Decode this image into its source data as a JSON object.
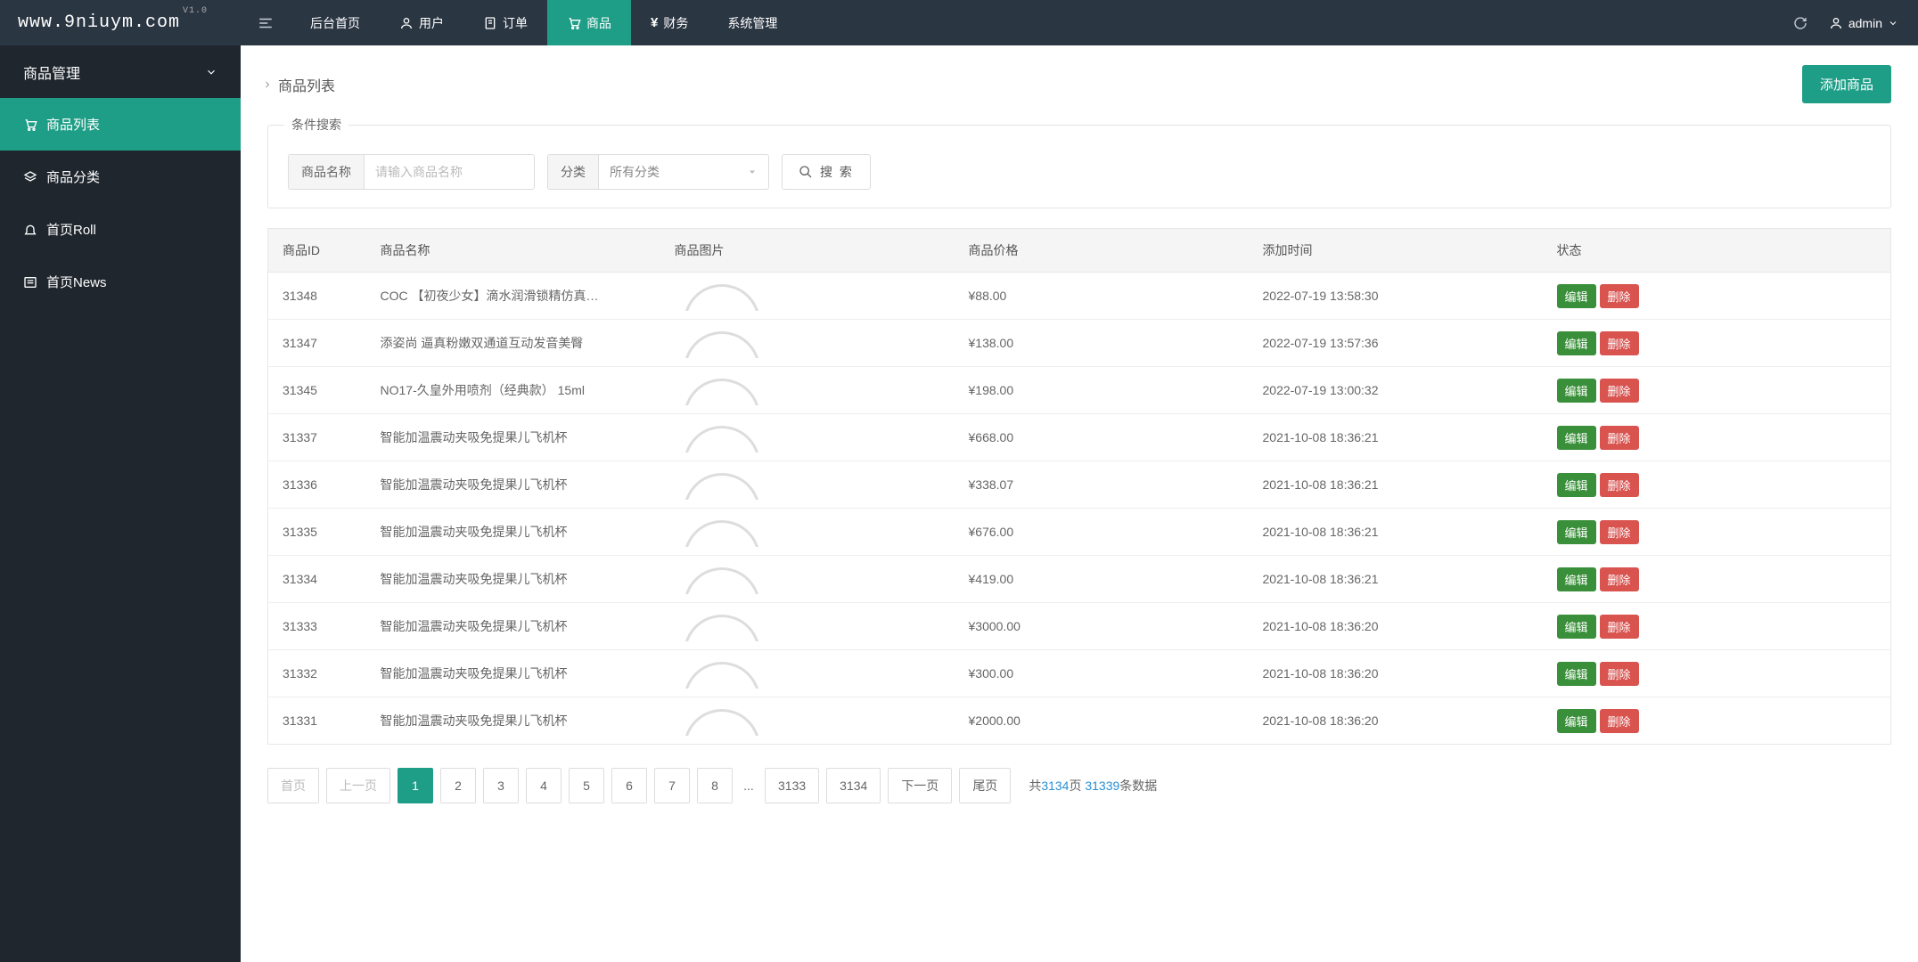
{
  "brand": {
    "name": "www.9niuym.com",
    "version": "V1.0"
  },
  "nav": {
    "items": [
      {
        "label": "后台首页",
        "icon": ""
      },
      {
        "label": "用户",
        "icon": "user"
      },
      {
        "label": "订单",
        "icon": "doc"
      },
      {
        "label": "商品",
        "icon": "cart",
        "active": true
      },
      {
        "label": "财务",
        "icon": "yen"
      },
      {
        "label": "系统管理",
        "icon": ""
      }
    ],
    "user": "admin"
  },
  "sidebar": {
    "group": "商品管理",
    "items": [
      {
        "label": "商品列表",
        "icon": "cart",
        "active": true
      },
      {
        "label": "商品分类",
        "icon": "layers"
      },
      {
        "label": "首页Roll",
        "icon": "bell"
      },
      {
        "label": "首页News",
        "icon": "news"
      }
    ]
  },
  "page": {
    "breadcrumb": "商品列表",
    "add_button": "添加商品"
  },
  "search": {
    "legend": "条件搜索",
    "name_label": "商品名称",
    "name_placeholder": "请输入商品名称",
    "cat_label": "分类",
    "cat_placeholder": "所有分类",
    "button": "搜 索"
  },
  "table": {
    "headers": [
      "商品ID",
      "商品名称",
      "商品图片",
      "商品价格",
      "添加时间",
      "状态"
    ],
    "edit_label": "编辑",
    "delete_label": "删除",
    "rows": [
      {
        "id": "31348",
        "name": "COC 【初夜少女】滴水润滑锁精仿真…",
        "price": "¥88.00",
        "time": "2022-07-19 13:58:30"
      },
      {
        "id": "31347",
        "name": "添姿尚 逼真粉嫩双通道互动发音美臀",
        "price": "¥138.00",
        "time": "2022-07-19 13:57:36"
      },
      {
        "id": "31345",
        "name": "NO17-久皇外用喷剂（经典款） 15ml",
        "price": "¥198.00",
        "time": "2022-07-19 13:00:32"
      },
      {
        "id": "31337",
        "name": "智能加温震动夹吸免提果儿飞机杯",
        "price": "¥668.00",
        "time": "2021-10-08 18:36:21"
      },
      {
        "id": "31336",
        "name": "智能加温震动夹吸免提果儿飞机杯",
        "price": "¥338.07",
        "time": "2021-10-08 18:36:21"
      },
      {
        "id": "31335",
        "name": "智能加温震动夹吸免提果儿飞机杯",
        "price": "¥676.00",
        "time": "2021-10-08 18:36:21"
      },
      {
        "id": "31334",
        "name": "智能加温震动夹吸免提果儿飞机杯",
        "price": "¥419.00",
        "time": "2021-10-08 18:36:21"
      },
      {
        "id": "31333",
        "name": "智能加温震动夹吸免提果儿飞机杯",
        "price": "¥3000.00",
        "time": "2021-10-08 18:36:20"
      },
      {
        "id": "31332",
        "name": "智能加温震动夹吸免提果儿飞机杯",
        "price": "¥300.00",
        "time": "2021-10-08 18:36:20"
      },
      {
        "id": "31331",
        "name": "智能加温震动夹吸免提果儿飞机杯",
        "price": "¥2000.00",
        "time": "2021-10-08 18:36:20"
      }
    ]
  },
  "pagination": {
    "first": "首页",
    "prev": "上一页",
    "next": "下一页",
    "last": "尾页",
    "pages": [
      "1",
      "2",
      "3",
      "4",
      "5",
      "6",
      "7",
      "8",
      "...",
      "3133",
      "3134"
    ],
    "current": "1",
    "info_prefix": "共",
    "total_pages": "3134",
    "info_mid": "页 ",
    "total_records": "31339",
    "info_suffix": "条数据"
  }
}
